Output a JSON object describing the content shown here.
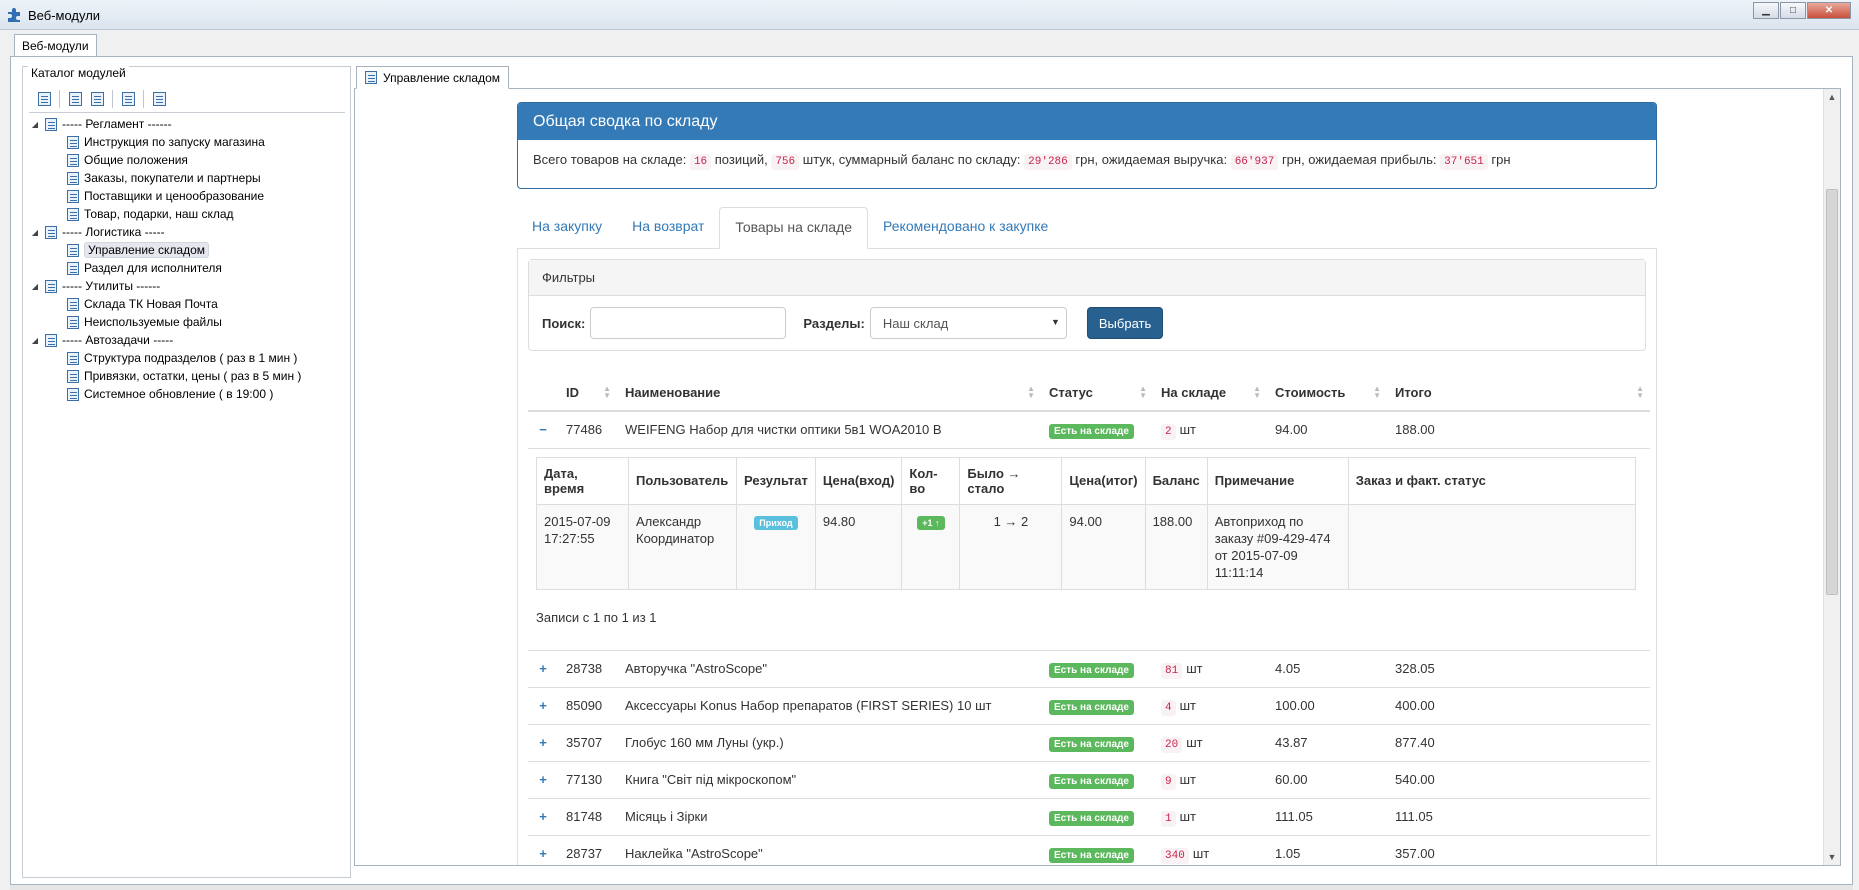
{
  "window": {
    "title": "Веб-модули",
    "controls": {
      "minimize": "▁",
      "maximize": "□",
      "close": "✕"
    }
  },
  "outer_tab": "Веб-модули",
  "catalog": {
    "label": "Каталог модулей",
    "toolbar_icons": [
      "add-module-icon",
      "move-module-icon",
      "add-child-icon",
      "delete-module-icon",
      "properties-icon"
    ],
    "tree": [
      {
        "label": "----- Регламент ------",
        "level": 0
      },
      {
        "label": "Инструкция по запуску магазина",
        "level": 1
      },
      {
        "label": "Общие положения",
        "level": 1
      },
      {
        "label": "Заказы, покупатели и партнеры",
        "level": 1
      },
      {
        "label": "Поставщики и ценообразование",
        "level": 1
      },
      {
        "label": "Товар, подарки, наш склад",
        "level": 1
      },
      {
        "label": "----- Логистика -----",
        "level": 0
      },
      {
        "label": "Управление складом",
        "level": 1,
        "selected": true
      },
      {
        "label": "Раздел для исполнителя",
        "level": 1
      },
      {
        "label": "----- Утилиты ------",
        "level": 0
      },
      {
        "label": "Склада ТК Новая Почта",
        "level": 1
      },
      {
        "label": "Неиспользуемые файлы",
        "level": 1
      },
      {
        "label": "----- Автозадачи -----",
        "level": 0
      },
      {
        "label": "Структура подразделов ( раз в 1 мин )",
        "level": 1
      },
      {
        "label": "Привязки, остатки, цены ( раз в 5 мин )",
        "level": 1
      },
      {
        "label": "Системное обновление ( в 19:00 )",
        "level": 1
      }
    ]
  },
  "inner_tab": "Управление складом",
  "summary": {
    "title": "Общая сводка по складу",
    "t1": "Всего товаров на складе:",
    "positions": "16",
    "t2": "позиций,",
    "pieces": "756",
    "t3": "штук, суммарный баланс по складу:",
    "balance": "29'286",
    "t4": "грн, ожидаемая выручка:",
    "revenue": "66'937",
    "t5": "грн, ожидаемая прибыль:",
    "profit": "37'651",
    "t6": "грн"
  },
  "tabs": [
    "На закупку",
    "На возврат",
    "Товары на складе",
    "Рекомендовано к закупке"
  ],
  "active_tab": "Товары на складе",
  "filters": {
    "title": "Фильтры",
    "search_label": "Поиск:",
    "search_value": "",
    "sections_label": "Разделы:",
    "sections_value": "Наш склад",
    "submit": "Выбрать"
  },
  "table": {
    "headers": [
      "ID",
      "Наименование",
      "Статус",
      "На складе",
      "Стоимость",
      "Итого"
    ],
    "rows": [
      {
        "expander": "−",
        "id": "77486",
        "name": "WEIFENG Набор для чистки оптики 5в1 WOA2010 B",
        "status": "Есть на складе",
        "qty": "2",
        "unit": "шт",
        "price": "94.00",
        "total": "188.00",
        "expanded": true
      },
      {
        "expander": "+",
        "id": "28738",
        "name": "Авторучка \"AstroScope\"",
        "status": "Есть на складе",
        "qty": "81",
        "unit": "шт",
        "price": "4.05",
        "total": "328.05"
      },
      {
        "expander": "+",
        "id": "85090",
        "name": "Аксессуары Konus Набор препаратов (FIRST SERIES) 10 шт",
        "status": "Есть на складе",
        "qty": "4",
        "unit": "шт",
        "price": "100.00",
        "total": "400.00"
      },
      {
        "expander": "+",
        "id": "35707",
        "name": "Глобус 160 мм Луны (укр.)",
        "status": "Есть на складе",
        "qty": "20",
        "unit": "шт",
        "price": "43.87",
        "total": "877.40"
      },
      {
        "expander": "+",
        "id": "77130",
        "name": "Книга \"Світ під мікроскопом\"",
        "status": "Есть на складе",
        "qty": "9",
        "unit": "шт",
        "price": "60.00",
        "total": "540.00"
      },
      {
        "expander": "+",
        "id": "81748",
        "name": "Місяць і Зірки",
        "status": "Есть на складе",
        "qty": "1",
        "unit": "шт",
        "price": "111.05",
        "total": "111.05"
      },
      {
        "expander": "+",
        "id": "28737",
        "name": "Наклейка \"AstroScope\"",
        "status": "Есть на складе",
        "qty": "340",
        "unit": "шт",
        "price": "1.05",
        "total": "357.00"
      }
    ]
  },
  "detail": {
    "headers": [
      "Дата, время",
      "Пользователь",
      "Результат",
      "Цена(вход)",
      "Кол-во",
      "Было → стало",
      "Цена(итог)",
      "Баланс",
      "Примечание",
      "Заказ и факт. статус"
    ],
    "row": {
      "datetime": "2015-07-09 17:27:55",
      "user": "Александр Координатор",
      "result": "Приход",
      "price_in": "94.80",
      "qty": "+1 ↑",
      "was_became": "1 → 2",
      "price_final": "94.00",
      "balance": "188.00",
      "note": "Автоприход по заказу #09-429-474 от 2015-07-09 11:11:14",
      "order_status": ""
    },
    "records": "Записи с 1 по 1 из 1"
  },
  "colors": {
    "primary": "#337ab7",
    "success": "#5cb85c",
    "info": "#5bc0de",
    "code": "#c7254e"
  }
}
